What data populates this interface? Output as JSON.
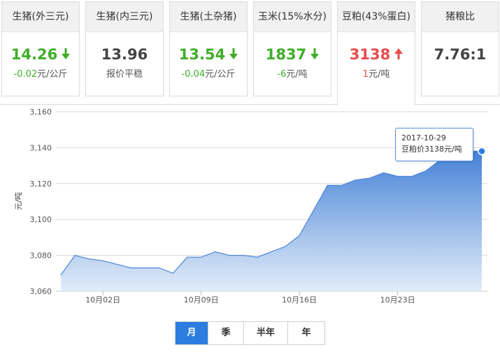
{
  "cards": [
    {
      "title": "生猪(外三元)",
      "value": "14.26",
      "trend": "down",
      "change_num": "-0.02",
      "change_unit": "元/公斤"
    },
    {
      "title": "生猪(内三元)",
      "value": "13.96",
      "trend": "flat",
      "change_num": "",
      "change_unit": "报价平稳"
    },
    {
      "title": "生猪(土杂猪)",
      "value": "13.54",
      "trend": "down",
      "change_num": "-0.04",
      "change_unit": "元/公斤"
    },
    {
      "title": "玉米(15%水分)",
      "value": "1837",
      "trend": "down",
      "change_num": "-6",
      "change_unit": "元/吨"
    },
    {
      "title": "豆粕(43%蛋白)",
      "value": "3138",
      "trend": "up",
      "change_num": "1",
      "change_unit": "元/吨"
    },
    {
      "title": "猪粮比",
      "value": "7.76:1",
      "trend": "flat",
      "change_num": "",
      "change_unit": ""
    }
  ],
  "icons": {
    "down": "arrow-down-icon",
    "up": "arrow-up-icon"
  },
  "colors": {
    "down": "#3fae29",
    "up": "#e74c4c",
    "accent": "#2b7de0",
    "line": "#4a86d8"
  },
  "tooltip": {
    "date": "2017-10-29",
    "text": "豆粕价3138元/吨"
  },
  "ranges": [
    {
      "label": "月",
      "active": true
    },
    {
      "label": "季",
      "active": false
    },
    {
      "label": "半年",
      "active": false
    },
    {
      "label": "年",
      "active": false
    }
  ],
  "chart_data": {
    "type": "area",
    "ylabel": "元/吨",
    "ylim": [
      3060,
      3160
    ],
    "yticks": [
      "3,060",
      "3,080",
      "3,100",
      "3,120",
      "3,140",
      "3,160"
    ],
    "xticks": [
      "10月02日",
      "10月09日",
      "10月16日",
      "10月23日"
    ],
    "grid": true,
    "series": [
      {
        "x": [
          "2017-09-29",
          "2017-09-30",
          "2017-10-01",
          "2017-10-02",
          "2017-10-03",
          "2017-10-04",
          "2017-10-05",
          "2017-10-06",
          "2017-10-07",
          "2017-10-08",
          "2017-10-09",
          "2017-10-10",
          "2017-10-11",
          "2017-10-12",
          "2017-10-13",
          "2017-10-14",
          "2017-10-15",
          "2017-10-16",
          "2017-10-17",
          "2017-10-18",
          "2017-10-19",
          "2017-10-20",
          "2017-10-21",
          "2017-10-22",
          "2017-10-23",
          "2017-10-24",
          "2017-10-25",
          "2017-10-26",
          "2017-10-27",
          "2017-10-28",
          "2017-10-29"
        ],
        "values": [
          3069,
          3080,
          3078,
          3077,
          3075,
          3073,
          3073,
          3073,
          3070,
          3079,
          3079,
          3082,
          3080,
          3080,
          3079,
          3082,
          3085,
          3091,
          3105,
          3119,
          3119,
          3122,
          3123,
          3126,
          3124,
          3124,
          3127,
          3133,
          3138,
          3138,
          3138
        ]
      }
    ]
  }
}
